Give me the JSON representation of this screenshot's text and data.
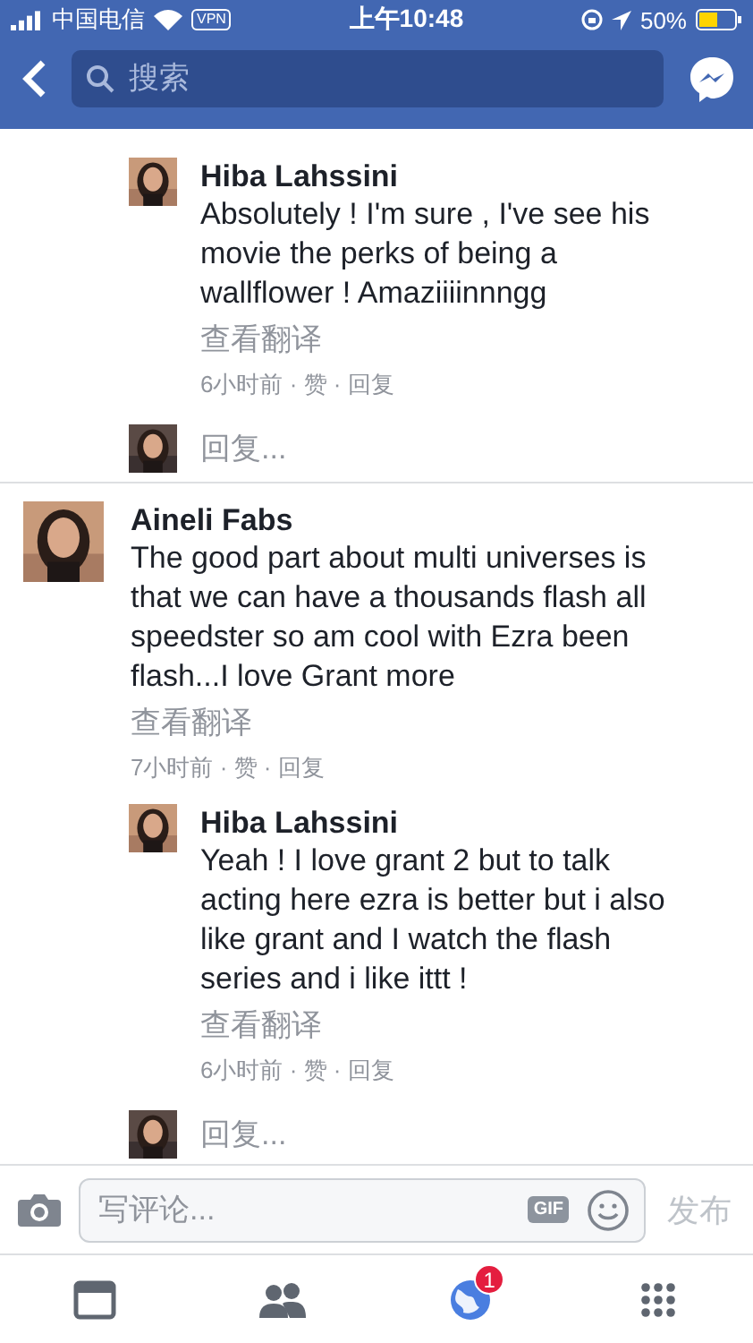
{
  "status_bar": {
    "carrier": "中国电信",
    "vpn": "VPN",
    "time": "上午10:48",
    "battery": "50%"
  },
  "nav": {
    "search_placeholder": "搜索"
  },
  "items": [
    {
      "kind": "reply",
      "author": "Hiba Lahssini",
      "text": "Absolutely ! I'm sure , I've see his movie the perks of being a wallflower ! Amaziiiinnngg",
      "translate": "查看翻译",
      "meta": "6小时前 · 赞 · 回复"
    },
    {
      "kind": "reply_box",
      "placeholder": "回复..."
    },
    {
      "kind": "comment",
      "author": "Aineli Fabs",
      "text": "The good part about multi universes is that we can have a thousands flash all speedster so am cool with Ezra been flash...I love Grant more",
      "translate": "查看翻译",
      "meta": "7小时前 · 赞 · 回复"
    },
    {
      "kind": "reply",
      "author": "Hiba Lahssini",
      "text": "Yeah ! I love grant 2 but to talk acting here ezra is better but i also like grant and I watch the flash series and i like ittt !",
      "translate": "查看翻译",
      "meta": "6小时前 · 赞 · 回复"
    },
    {
      "kind": "reply_box",
      "placeholder": "回复..."
    }
  ],
  "composer": {
    "placeholder": "写评论...",
    "gif": "GIF",
    "post": "发布",
    "post_disabled": true
  },
  "tabs": [
    {
      "kind": "feed",
      "selected": false
    },
    {
      "kind": "friends",
      "selected": false
    },
    {
      "kind": "notifications",
      "selected": true,
      "badge": "1"
    },
    {
      "kind": "menu",
      "selected": false
    }
  ]
}
